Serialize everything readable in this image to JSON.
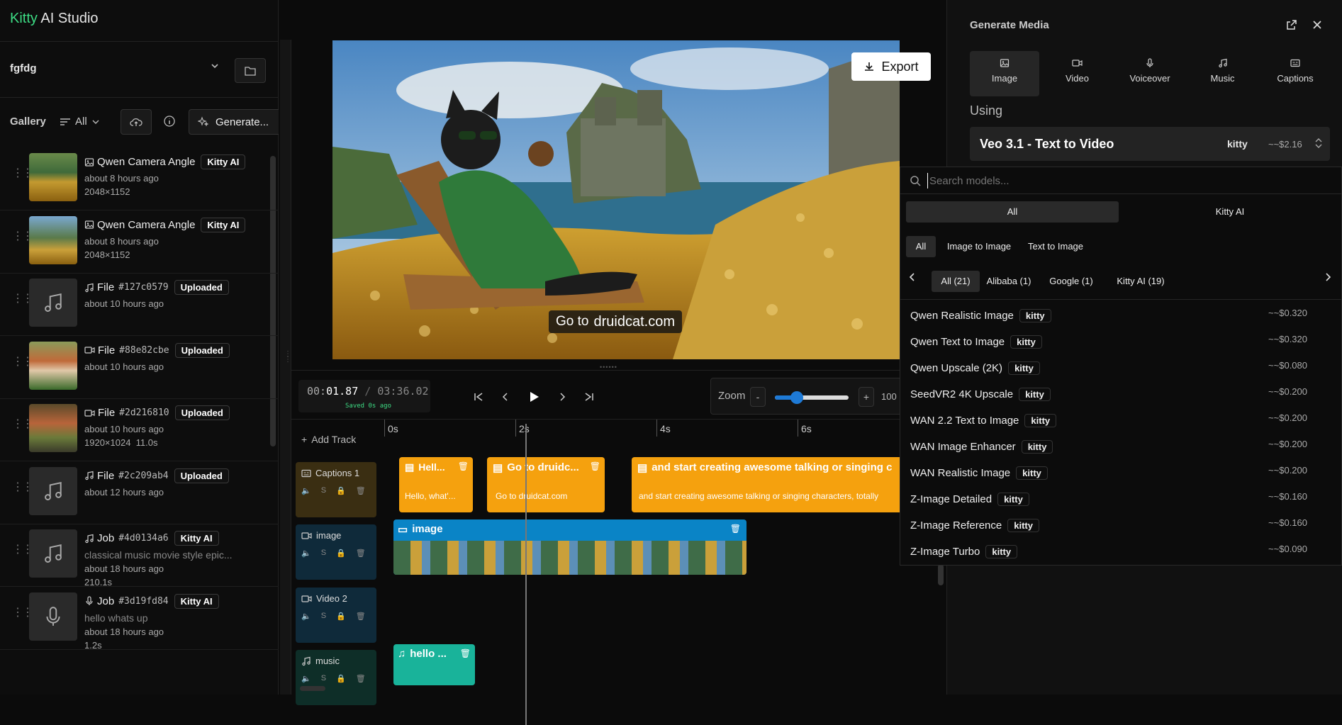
{
  "app": {
    "title_accent": "Kitty",
    "title_rest": " AI Studio"
  },
  "project": {
    "name": "fgfdg"
  },
  "gallery": {
    "label": "Gallery",
    "filter": "All",
    "generate_label": "Generate...",
    "items": [
      {
        "title": "Qwen Camera Angle",
        "badge": "Kitty AI",
        "time": "about 8 hours ago",
        "detail": "2048×1152",
        "icon": "image-icon",
        "thumb": "gold"
      },
      {
        "title": "Qwen Camera Angle",
        "badge": "Kitty AI",
        "time": "about 8 hours ago",
        "detail": "2048×1152",
        "icon": "image-icon",
        "thumb": "castle"
      },
      {
        "title": "File",
        "code": "#127c0579",
        "badge": "Uploaded",
        "time": "about 10 hours ago",
        "detail": "",
        "icon": "music-icon",
        "thumb": "music"
      },
      {
        "title": "File",
        "code": "#88e82cbe",
        "badge": "Uploaded",
        "time": "about 10 hours ago",
        "detail": "",
        "icon": "video-icon",
        "thumb": "girl"
      },
      {
        "title": "File",
        "code": "#2d216810",
        "badge": "Uploaded",
        "time": "about 10 hours ago",
        "detail": "1920×1024  11.0s",
        "icon": "video-icon",
        "thumb": "girl2"
      },
      {
        "title": "File",
        "code": "#2c209ab4",
        "badge": "Uploaded",
        "time": "about 12 hours ago",
        "detail": "",
        "icon": "music-icon",
        "thumb": "music"
      },
      {
        "title": "Job",
        "code": "#4d0134a6",
        "badge": "Kitty AI",
        "sub": "classical music movie style epic...",
        "time": "about 18 hours ago",
        "detail": "210.1s",
        "icon": "music-icon",
        "thumb": "music"
      },
      {
        "title": "Job",
        "code": "#3d19fd84",
        "badge": "Kitty AI",
        "sub": "hello whats up",
        "time": "about 18 hours ago",
        "detail": "1.2s",
        "icon": "mic-icon",
        "thumb": "mic"
      }
    ]
  },
  "preview": {
    "export_label": "Export",
    "caption_pre": "Go to",
    "caption_main": "druidcat.com"
  },
  "transport": {
    "time_current_dim": "00:",
    "time_current": "01.87",
    "time_sep": " / ",
    "time_total": "03:36.02",
    "saved": "Saved 0s ago",
    "zoom_label": "Zoom",
    "zoom_minus": "-",
    "zoom_plus": "+",
    "zoom_value": "100",
    "zoom_level": 0.3
  },
  "timeline": {
    "add_track": "Add Track",
    "ruler": [
      "0s",
      "2s",
      "4s",
      "6s"
    ],
    "tracks": [
      {
        "name": "Captions 1",
        "icon": "captions-icon"
      },
      {
        "name": "image",
        "icon": "video-icon"
      },
      {
        "name": "Video 2",
        "icon": "video-icon"
      },
      {
        "name": "music",
        "icon": "music-icon"
      }
    ],
    "clips": {
      "c1_title": "Hell...",
      "c1_text": "Hello, what'...",
      "c2_title": "Go to druidc...",
      "c2_text": "Go to druidcat.com",
      "c3_title": "and start creating awesome talking or singing c",
      "c3_text": "and start creating awesome talking or singing characters, totally",
      "image_title": "image",
      "music_title": "hello ..."
    }
  },
  "panel": {
    "title": "Generate Media",
    "tabs": [
      {
        "label": "Image",
        "icon": "image-icon"
      },
      {
        "label": "Video",
        "icon": "video-icon"
      },
      {
        "label": "Voiceover",
        "icon": "mic-icon"
      },
      {
        "label": "Music",
        "icon": "music-icon"
      },
      {
        "label": "Captions",
        "icon": "captions-icon"
      }
    ],
    "using_label": "Using",
    "model_name": "Veo 3.1 - Text to Video",
    "model_provider": "kitty",
    "model_price": "~~$2.16"
  },
  "dropdown": {
    "search_placeholder": "Search models...",
    "provider_tabs": [
      "All",
      "Kitty AI"
    ],
    "type_tabs": [
      "All",
      "Image to Image",
      "Text to Image"
    ],
    "vendor_tabs": [
      "All (21)",
      "Alibaba (1)",
      "Google (1)",
      "Kitty AI (19)"
    ],
    "models": [
      {
        "name": "Qwen Realistic Image",
        "provider": "kitty",
        "price": "~~$0.320"
      },
      {
        "name": "Qwen Text to Image",
        "provider": "kitty",
        "price": "~~$0.320"
      },
      {
        "name": "Qwen Upscale (2K)",
        "provider": "kitty",
        "price": "~~$0.080"
      },
      {
        "name": "SeedVR2 4K Upscale",
        "provider": "kitty",
        "price": "~~$0.200"
      },
      {
        "name": "WAN 2.2 Text to Image",
        "provider": "kitty",
        "price": "~~$0.200"
      },
      {
        "name": "WAN Image Enhancer",
        "provider": "kitty",
        "price": "~~$0.200"
      },
      {
        "name": "WAN Realistic Image",
        "provider": "kitty",
        "price": "~~$0.200"
      },
      {
        "name": "Z-Image Detailed",
        "provider": "kitty",
        "price": "~~$0.160"
      },
      {
        "name": "Z-Image Reference",
        "provider": "kitty",
        "price": "~~$0.160"
      },
      {
        "name": "Z-Image Turbo",
        "provider": "kitty",
        "price": "~~$0.090"
      }
    ]
  }
}
